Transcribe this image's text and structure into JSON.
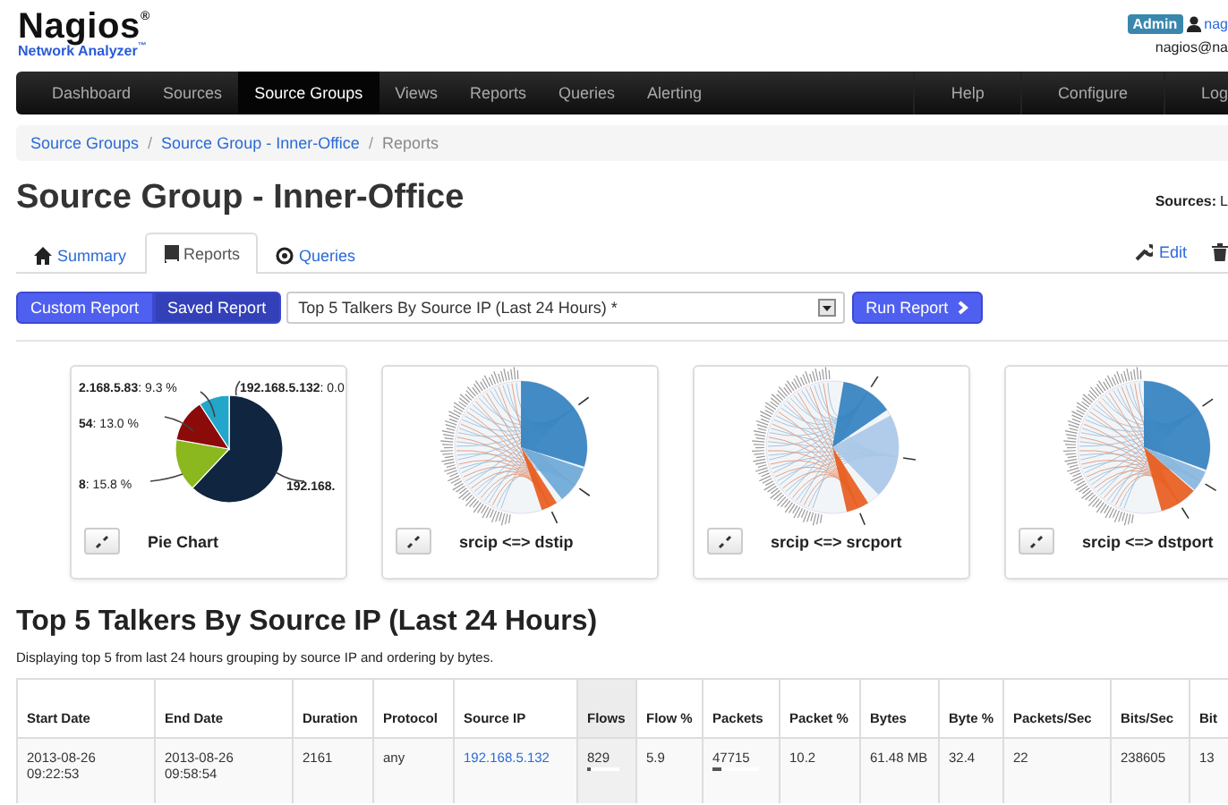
{
  "header": {
    "logo": "Nagios$^{®}$",
    "logo_subtitle": "Network Analyzer$^{™}$",
    "user_badge": "Admin",
    "user_name": "nag",
    "user_email": "nagios@na"
  },
  "nav": {
    "items": [
      {
        "label": "Dashboard",
        "selected": false
      },
      {
        "label": "Sources",
        "selected": false
      },
      {
        "label": "Source Groups",
        "selected": true
      },
      {
        "label": "Views",
        "selected": false
      },
      {
        "label": "Reports",
        "selected": false
      },
      {
        "label": "Queries",
        "selected": false
      },
      {
        "label": "Alerting",
        "selected": false
      }
    ],
    "right_items": [
      {
        "label": "Help"
      },
      {
        "label": "Configure"
      },
      {
        "label": "Log"
      }
    ]
  },
  "breadcrumb": [
    {
      "label": "Source Groups",
      "current": false
    },
    {
      "divider": "/",
      "label": "Source Group - Inner-Office",
      "current": false
    },
    {
      "divider": "/",
      "label": "Reports",
      "current": true
    }
  ],
  "page_title": "Source Group - Inner-Office",
  "sources": {
    "label": "Sources:",
    "value": "L"
  },
  "tabs": [
    {
      "label": "Summary",
      "kind": "home",
      "selected": false
    },
    {
      "label": "Reports",
      "kind": "book",
      "selected": true
    },
    {
      "label": "Queries",
      "kind": "circle",
      "selected": false
    }
  ],
  "actions": [
    {
      "label": "Edit",
      "kind": "wrench"
    },
    {
      "kind": "trash"
    }
  ],
  "report_mode": [
    {
      "label": "Custom Report",
      "selected": false
    },
    {
      "label": "Saved Report",
      "selected": true
    }
  ],
  "report_select": {
    "value": "Top 5 Talkers By Source IP (Last 24 Hours) *"
  },
  "run_button": "Run Report",
  "charts": [
    {
      "kind": "pie",
      "caption": "Pie Chart",
      "labels": [
        "**2.168.5.83**: 9.3 %",
        "**192.168.5.132**: 0.0",
        "**54**: 13.0 %",
        "**8**: 15.8 %",
        "**192.168.**"
      ]
    },
    {
      "kind": "chord",
      "caption": "srcip <=> dstip"
    },
    {
      "kind": "chord",
      "caption": "srcip <=> srcport"
    },
    {
      "kind": "chord",
      "caption": "srcip <=> dstport"
    }
  ],
  "report": {
    "title": "Top 5 Talkers By Source IP (Last 24 Hours)",
    "description": "Displaying top 5 from last 24 hours grouping by source IP and ordering by bytes.",
    "columns": [
      {
        "label": "Start Date",
        "sorted": false
      },
      {
        "label": "End Date",
        "sorted": false
      },
      {
        "label": "Duration",
        "sorted": false
      },
      {
        "label": "Protocol",
        "sorted": false
      },
      {
        "label": "Source IP",
        "sorted": false
      },
      {
        "label": "Flows",
        "sorted": true
      },
      {
        "label": "Flow %",
        "sorted": false
      },
      {
        "label": "Packets",
        "sorted": false
      },
      {
        "label": "Packet %",
        "sorted": false
      },
      {
        "label": "Bytes",
        "sorted": false
      },
      {
        "label": "Byte %",
        "sorted": false
      },
      {
        "label": "Packets/Sec",
        "sorted": false
      },
      {
        "label": "Bits/Sec",
        "sorted": false
      },
      {
        "label": "Bit",
        "sorted": false
      }
    ],
    "rows": [
      [
        {
          "text": "2013-08-26 09:22:53"
        },
        {
          "text": "2013-08-26 09:58:54"
        },
        {
          "text": "2161"
        },
        {
          "text": "any"
        },
        {
          "text": "192.168.5.132",
          "kind": "link"
        },
        {
          "text": "829",
          "kind": "bar",
          "level": 0.12
        },
        {
          "text": "5.9"
        },
        {
          "text": "47715",
          "kind": "bar",
          "level": 0.2
        },
        {
          "text": "10.2"
        },
        {
          "text": "61.48 MB"
        },
        {
          "text": "32.4"
        },
        {
          "text": "22"
        },
        {
          "text": "238605"
        },
        {
          "text": "13"
        }
      ]
    ]
  }
}
